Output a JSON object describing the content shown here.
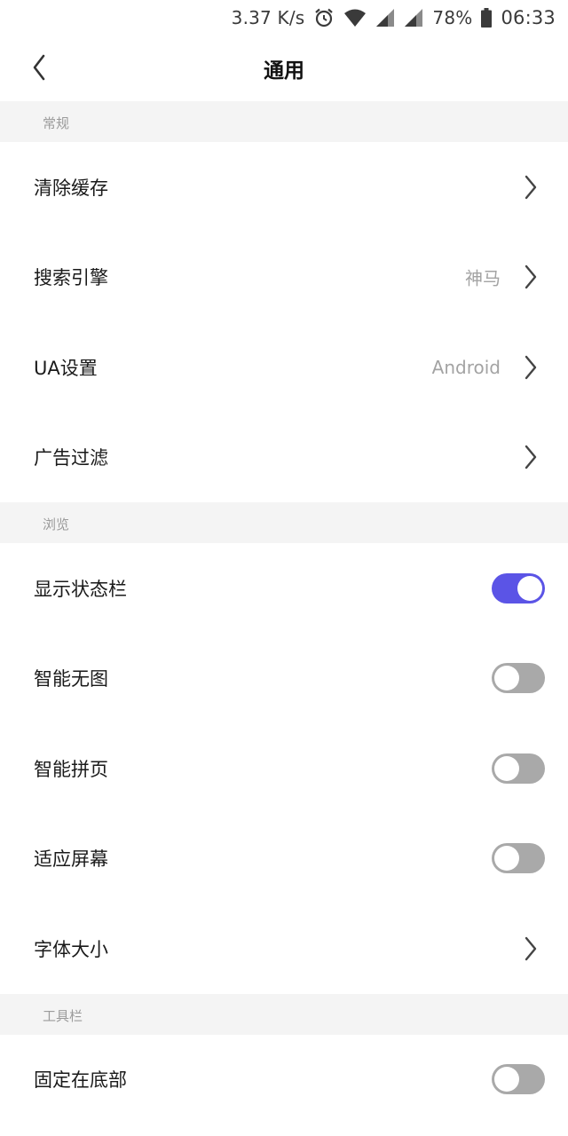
{
  "status_bar": {
    "speed": "3.37 K/s",
    "battery": "78%",
    "time": "06:33"
  },
  "header": {
    "title": "通用"
  },
  "sections": {
    "general": {
      "title": "常规",
      "clear_cache": "清除缓存",
      "search_engine": "搜索引擎",
      "search_engine_value": "神马",
      "ua_settings": "UA设置",
      "ua_value": "Android",
      "ad_filter": "广告过滤"
    },
    "browse": {
      "title": "浏览",
      "show_status_bar": "显示状态栏",
      "show_status_bar_on": true,
      "smart_no_image": "智能无图",
      "smart_no_image_on": false,
      "smart_paging": "智能拼页",
      "smart_paging_on": false,
      "fit_screen": "适应屏幕",
      "fit_screen_on": false,
      "font_size": "字体大小"
    },
    "toolbar": {
      "title": "工具栏",
      "fixed_bottom": "固定在底部",
      "fixed_bottom_on": false
    }
  },
  "colors": {
    "accent": "#5b54e6",
    "toggle_off": "#a9a9a9",
    "section_bg": "#f4f4f4"
  },
  "icons": {
    "back": "chevron-left-icon",
    "row_arrow": "chevron-right-icon",
    "alarm": "alarm-icon",
    "wifi": "wifi-icon",
    "signal": "signal-icon",
    "battery": "battery-icon"
  }
}
